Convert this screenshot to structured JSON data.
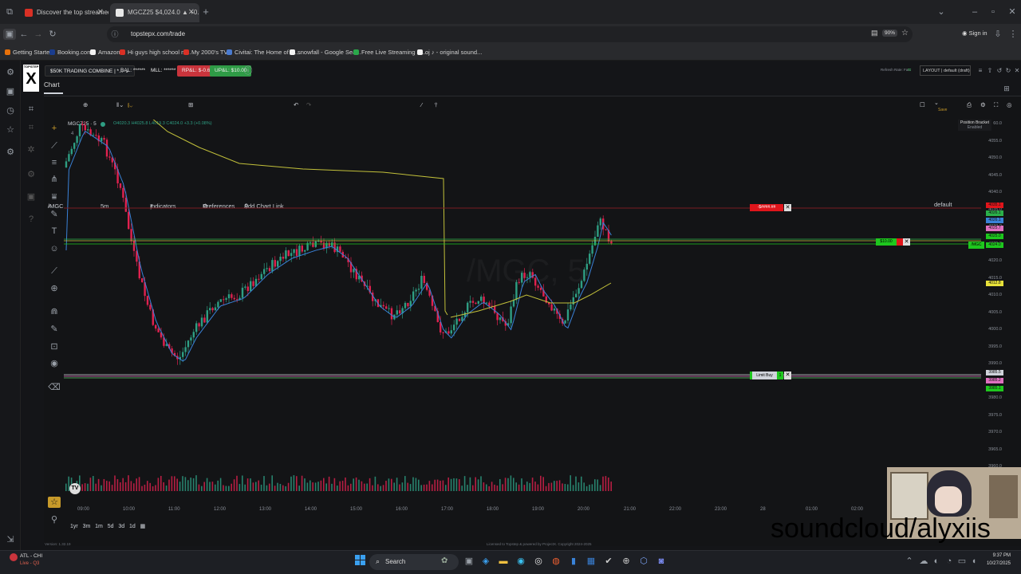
{
  "browser": {
    "tabs": [
      {
        "title": "Discover the top streamed mu",
        "active": false,
        "favicon_color": "#d93025"
      },
      {
        "title": "MGCZ25 $4,024.0 ▲ +0.11%",
        "active": true,
        "favicon_color": "#e8e8e8"
      }
    ],
    "new_tab_icon": "plus-icon",
    "url": "topstepx.com/trade",
    "zoom": "90%",
    "sign_in": "Sign in",
    "bookmarks": [
      {
        "label": "Getting Started",
        "color": "#e8710a"
      },
      {
        "label": "Booking.com",
        "color": "#1a3d8f"
      },
      {
        "label": "Amazon",
        "color": "#f2f2f2"
      },
      {
        "label": "Hi guys high school m...",
        "color": "#d93025"
      },
      {
        "label": "My 2000's TV!",
        "color": "#d93025"
      },
      {
        "label": "Civitai: The Home of O...",
        "color": "#4a7bd0"
      },
      {
        "label": "snowfall - Google Sea...",
        "color": "#f2f2f2"
      },
      {
        "label": "Free Live Streaming &...",
        "color": "#2aa84a"
      },
      {
        "label": "oj ♪ - original sound...",
        "color": "#f2f2f2"
      }
    ]
  },
  "app": {
    "logo_top": "TOPSTEP",
    "logo_letter": "X",
    "account": "$50K TRADING COMBINE | *...",
    "bal": "BAL: ******",
    "mll": "MLL: ******",
    "rpnl": "RP&L: $-0.62",
    "upnl": "UP&L: $10.00",
    "refresh": "Refresh Rate: Fast",
    "layout": "LAYOUT | default (draft)",
    "chart_tab": "Chart",
    "toolbar": {
      "symbol": "/MGC",
      "timeframe": "5m",
      "indicators": "Indicators",
      "preferences": "Preferences",
      "add_chart_link": "Add Chart Link",
      "template": "default",
      "template_sub": "Save"
    },
    "legend": {
      "symbol": "MGCZ25 · 5",
      "ohlc": "O4020.3 H4025.8 L4019.3 C4024.0 +3.3 (+0.08%)",
      "count": "4"
    },
    "position_bracket": {
      "title": "Position Bracket",
      "status": "Enabled"
    },
    "watermark": "/MGC, 5",
    "orders": {
      "stop": {
        "label": "-$####.##",
        "price": "4035.1",
        "color": "#e0151b"
      },
      "position": {
        "label": "$10.00",
        "price": "4024.0",
        "tag": "/MGC",
        "color": "#1ec71e"
      },
      "limit": {
        "label": "Limit Buy",
        "qty": "1",
        "price": "3985.5",
        "color": "#1ec71e"
      }
    },
    "price_axis": {
      "ticks": [
        "60.0",
        "4055.0",
        "4050.0",
        "4045.0",
        "4040.0",
        "4035.0",
        "4030.0",
        "4025.0",
        "4020.0",
        "4015.0",
        "4010.0",
        "4005.0",
        "4000.0",
        "3995.0",
        "3990.0",
        "3985.0",
        "3980.0",
        "3975.0",
        "3970.0",
        "3965.0",
        "3960.0"
      ],
      "badges": [
        {
          "text": "4035.1",
          "color": "#e0151b"
        },
        {
          "text": "4026.1",
          "color": "#2bb04a"
        },
        {
          "text": "4026.1",
          "color": "#3a82d8"
        },
        {
          "text": "4025.7",
          "color": "#e070c0"
        },
        {
          "text": "4025.0",
          "color": "#1ec71e"
        },
        {
          "text": "4024.0",
          "color": "#1ec71e"
        },
        {
          "text": "4012.8",
          "color": "#e8e23a"
        },
        {
          "text": "3985.5",
          "color": "#cfd3da"
        },
        {
          "text": "3985.2",
          "color": "#e070c0"
        },
        {
          "text": "3985.1",
          "color": "#1ec71e"
        }
      ]
    },
    "time_axis": [
      "09:00",
      "10:00",
      "11:00",
      "12:00",
      "13:00",
      "14:00",
      "15:00",
      "16:00",
      "17:00",
      "18:00",
      "19:00",
      "20:00",
      "21:00",
      "22:00",
      "23:00",
      "28",
      "01:00",
      "02:00",
      "03:00"
    ],
    "ranges": [
      "1yr",
      "3m",
      "1m",
      "5d",
      "3d",
      "1d"
    ],
    "version": "Version: 1.32.19",
    "license": "Licensed to Topstep & powered by ProjectX. Copyright 2024-2025"
  },
  "overlay": {
    "text": "soundcloud/alyxiis"
  },
  "taskbar": {
    "weather_temp": "ATL - CHI",
    "weather_sub": "Live - Q3",
    "search": "Search",
    "time": "9:37 PM",
    "date": "10/27/2025"
  },
  "colors": {
    "up": "#2e9e83",
    "down": "#e0214f",
    "ema_fast": "#3a82d8",
    "vwap": "#c2c03a"
  }
}
